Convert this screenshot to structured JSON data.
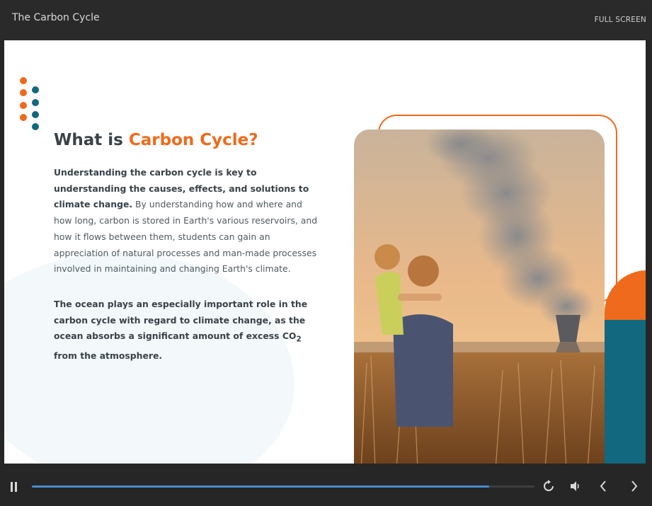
{
  "window": {
    "title": "The Carbon Cycle",
    "fullscreen_label": "FULL SCREEN"
  },
  "slide": {
    "heading_prefix": "What is ",
    "heading_accent": "Carbon Cycle?",
    "para1_bold": "Understanding the carbon cycle is key to understanding the causes, effects, and solutions to climate change.",
    "para1_rest": " By understanding how and where and how long, carbon is stored in Earth's various reservoirs, and how it flows between them, students can gain an appreciation of natural processes and man-made processes involved in maintaining and changing Earth's climate.",
    "para2_before": "The ocean plays an especially important role in the carbon cycle with regard to climate change, as the ocean absorbs a significant amount of excess CO",
    "para2_sub": "2",
    "para2_after": " from the atmosphere."
  },
  "player": {
    "progress": 0.91,
    "icons": [
      "pause-icon",
      "replay-icon",
      "volume-icon",
      "prev-icon",
      "next-icon"
    ]
  },
  "colors": {
    "accent_orange": "#ef6a1c",
    "accent_teal": "#12687f",
    "progress": "#4b8ad0"
  }
}
